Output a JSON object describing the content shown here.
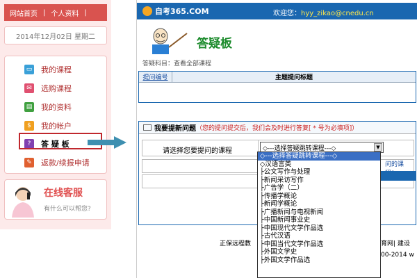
{
  "left": {
    "topbar": {
      "home": "网站首页",
      "profile": "个人资料"
    },
    "date": "2014年12月02日 星期二",
    "menu": [
      {
        "label": "我的课程",
        "icon": "monitor-icon",
        "color": "#3aa0d8"
      },
      {
        "label": "选购课程",
        "icon": "cart-icon",
        "color": "#e05070"
      },
      {
        "label": "我的资料",
        "icon": "profile-card-icon",
        "color": "#40a040"
      },
      {
        "label": "我的帐户",
        "icon": "dollar-icon",
        "color": "#f0a020"
      },
      {
        "label": "答 疑 板",
        "icon": "question-icon",
        "color": "#8040b0"
      },
      {
        "label": "返款/续报申请",
        "icon": "pencil-icon",
        "color": "#e06030"
      }
    ],
    "service": {
      "title": "在线客服",
      "subtitle": "有什么可以帮您?"
    }
  },
  "header": {
    "logo": "自考365.COM",
    "welcome_prefix": "欢迎您：",
    "welcome_user": "hyy_zikao@cnedu.cn"
  },
  "page": {
    "title": "答疑板",
    "subject": "答疑科目：查看全部课程",
    "grid_col1": "提问编号",
    "grid_col2": "主题提问标题"
  },
  "ask": {
    "head_title": "我要提新问题",
    "head_note": "（您的提问提交后，我们会及时进行答复[ * 号为必填项]）",
    "label": "请选择您要提问的课程",
    "select_value": "◇---选择答疑跳转课程---◇",
    "hint": "问的课程！"
  },
  "dropdown": [
    {
      "text": "◇---选择答疑跳转课程---◇",
      "selected": true
    },
    {
      "text": "◇汉语言类",
      "selected": false
    },
    {
      "text": "├公文写作与处理",
      "selected": false
    },
    {
      "text": "├新闻采访写作",
      "selected": false
    },
    {
      "text": "├广告学（二）",
      "selected": false
    },
    {
      "text": "├传播学概论",
      "selected": false
    },
    {
      "text": "├新闻学概论",
      "selected": false
    },
    {
      "text": "├广播新闻与电视新闻",
      "selected": false
    },
    {
      "text": "├中国新闻事业史",
      "selected": false
    },
    {
      "text": "├中国现代文学作品选",
      "selected": false
    },
    {
      "text": "├古代汉语",
      "selected": false
    },
    {
      "text": "├中国当代文学作品选",
      "selected": false
    },
    {
      "text": "├外国文学史",
      "selected": false
    },
    {
      "text": "├外国文学作品选",
      "selected": false
    }
  ],
  "footer": {
    "left": "正保远程教",
    "right": "育网| 建设",
    "copy": "00-2014 w"
  }
}
